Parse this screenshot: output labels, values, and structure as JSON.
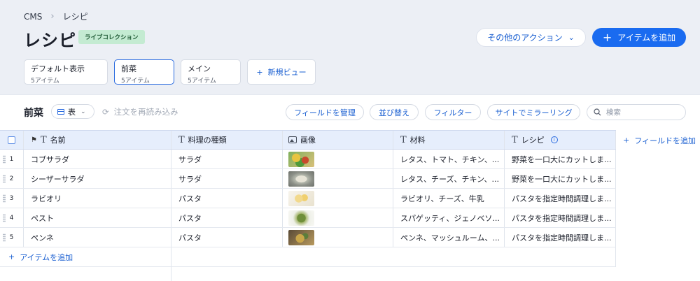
{
  "breadcrumb": {
    "root": "CMS",
    "current": "レシピ"
  },
  "header": {
    "title": "レシピ",
    "badge": "ライブコレクション",
    "more_actions": "その他のアクション",
    "add_item": "アイテムを追加"
  },
  "views": [
    {
      "name": "デフォルト表示",
      "count": "5アイテム"
    },
    {
      "name": "前菜",
      "count": "5アイテム"
    },
    {
      "name": "メイン",
      "count": "5アイテム"
    }
  ],
  "new_view": "新規ビュー",
  "toolbar": {
    "title": "前菜",
    "view_mode": "表",
    "reload": "注文を再読み込み",
    "manage_fields": "フィールドを管理",
    "sort": "並び替え",
    "filter": "フィルター",
    "mirror": "サイトでミラーリング",
    "search_placeholder": "検索"
  },
  "table": {
    "headers": {
      "name": "名前",
      "type": "料理の種類",
      "image": "画像",
      "material": "材料",
      "recipe": "レシピ"
    },
    "rows": [
      {
        "num": "1",
        "name": "コブサラダ",
        "type": "サラダ",
        "material": "レタス、トマト、チキン、...",
        "recipe": "野菜を一口大にカットしま..."
      },
      {
        "num": "2",
        "name": "シーザーサラダ",
        "type": "サラダ",
        "material": "レタス、チーズ、チキン、...",
        "recipe": "野菜を一口大にカットしま..."
      },
      {
        "num": "3",
        "name": "ラビオリ",
        "type": "パスタ",
        "material": "ラビオリ、チーズ、牛乳",
        "recipe": "パスタを指定時間調理しま..."
      },
      {
        "num": "4",
        "name": "ペスト",
        "type": "パスタ",
        "material": "スパゲッティ、ジェノベソ...",
        "recipe": "パスタを指定時間調理しま..."
      },
      {
        "num": "5",
        "name": "ペンネ",
        "type": "パスタ",
        "material": "ペンネ、マッシュルーム、...",
        "recipe": "パスタを指定時間調理しま..."
      }
    ],
    "add_field": "フィールドを追加",
    "add_item": "アイテムを追加"
  },
  "colors": {
    "accent": "#1a6bf0",
    "badge_bg": "#c4ebd2",
    "header_bg": "#e6eefc"
  }
}
